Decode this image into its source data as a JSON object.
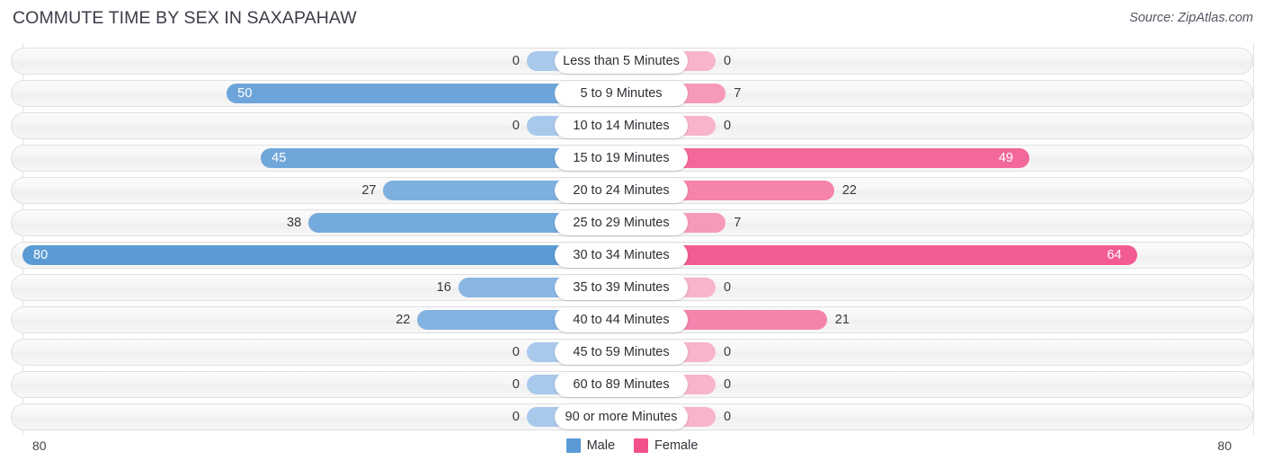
{
  "header": {
    "title": "COMMUTE TIME BY SEX IN SAXAPAHAW",
    "source": "Source: ZipAtlas.com"
  },
  "legend": {
    "items": [
      {
        "label": "Male",
        "color": "#5b9bd5"
      },
      {
        "label": "Female",
        "color": "#f4traversal"
      }
    ]
  },
  "axis": {
    "left_end": "80",
    "right_end": "80"
  },
  "colors": {
    "male_strong": "#5b9bd5",
    "male_weak": "#a9c9ec",
    "female_strong": "#f2508a",
    "female_weak": "#f8b4cd",
    "track": "#f4f4f4",
    "track_border": "#e0e0e0"
  },
  "chart_data": {
    "type": "bar",
    "subtype": "diverging-horizontal-bar",
    "title": "COMMUTE TIME BY SEX IN SAXAPAHAW",
    "xlabel": "",
    "ylabel": "",
    "xlim": [
      0,
      80
    ],
    "grid": false,
    "legend_position": "bottom-center",
    "categories": [
      "Less than 5 Minutes",
      "5 to 9 Minutes",
      "10 to 14 Minutes",
      "15 to 19 Minutes",
      "20 to 24 Minutes",
      "25 to 29 Minutes",
      "30 to 34 Minutes",
      "35 to 39 Minutes",
      "40 to 44 Minutes",
      "45 to 59 Minutes",
      "60 to 89 Minutes",
      "90 or more Minutes"
    ],
    "series": [
      {
        "name": "Male",
        "direction": "left",
        "values": [
          0,
          50,
          0,
          45,
          27,
          38,
          80,
          16,
          22,
          0,
          0,
          0
        ]
      },
      {
        "name": "Female",
        "direction": "right",
        "values": [
          0,
          7,
          0,
          49,
          22,
          7,
          64,
          0,
          21,
          0,
          0,
          0
        ]
      }
    ]
  }
}
